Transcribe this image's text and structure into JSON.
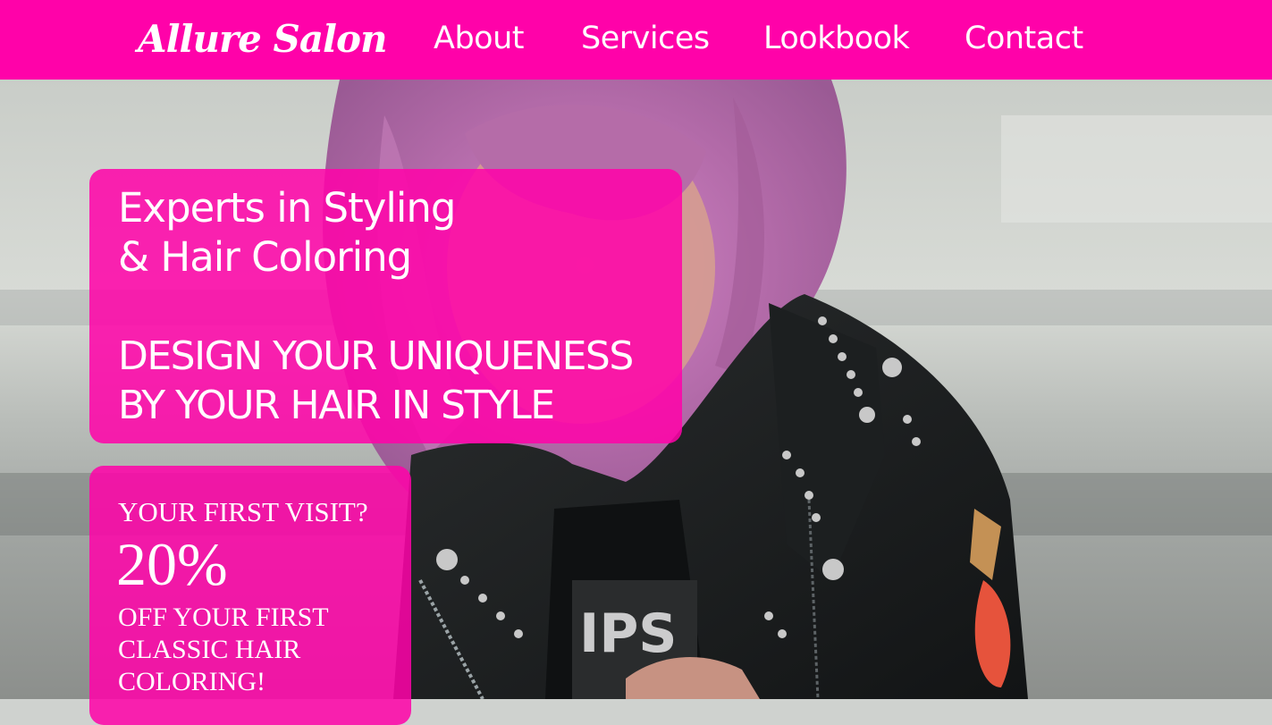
{
  "header": {
    "logo": "Allure Salon",
    "nav": [
      "About",
      "Services",
      "Lookbook",
      "Contact"
    ]
  },
  "hero": {
    "headline": [
      "Experts in Styling",
      "& Hair Coloring"
    ],
    "tagline": [
      "DESIGN YOUR UNIQUENESS",
      "BY YOUR HAIR IN STYLE"
    ]
  },
  "offer": {
    "question": "YOUR FIRST VISIT?",
    "discount": "20%",
    "details": [
      "OFF YOUR FIRST",
      "CLASSIC HAIR",
      "COLORING!"
    ]
  },
  "colors": {
    "brand_pink": "#ff02a9",
    "text": "#ffffff"
  }
}
